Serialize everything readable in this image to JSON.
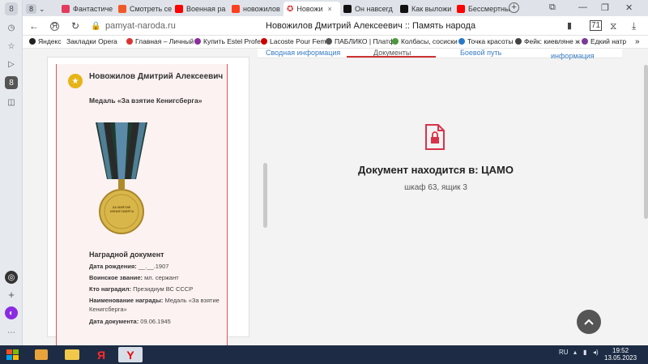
{
  "tabs": [
    {
      "label": "8",
      "icon": "tab-counter-icon"
    },
    {
      "label": "Фантастиче",
      "icon": "m-icon",
      "color": "#e23b5b"
    },
    {
      "label": "Смотреть се",
      "icon": "play-icon",
      "color": "#f05a28"
    },
    {
      "label": "Военная ра",
      "icon": "youtube-icon",
      "color": "#ff0000"
    },
    {
      "label": "новожилов",
      "icon": "yandex-icon",
      "color": "#fc3f1d"
    },
    {
      "label": "Новожи",
      "icon": "star-icon",
      "color": "#d33",
      "active": true
    },
    {
      "label": "Он навсегд",
      "icon": "plus-icon",
      "color": "#111"
    },
    {
      "label": "Как выложи",
      "icon": "plus-icon",
      "color": "#111"
    },
    {
      "label": "Бессмертны",
      "icon": "youtube-icon",
      "color": "#ff0000"
    }
  ],
  "address": {
    "url": "pamyat-naroda.ru",
    "title": "Новожилов Дмитрий Алексеевич :: Память народа"
  },
  "bookmarks": [
    {
      "label": "Яндекс",
      "color": "#222"
    },
    {
      "label": "Закладки Opera",
      "color": "#888"
    },
    {
      "label": "Главная – Личный",
      "color": "#d33"
    },
    {
      "label": "Купить Estel Profe",
      "color": "#8b2d9b"
    },
    {
      "label": "Lacoste Pour Femi",
      "color": "#c00"
    },
    {
      "label": "ПАБЛИКО | Платф",
      "color": "#555"
    },
    {
      "label": "Колбасы, сосиски",
      "color": "#4a9a3a"
    },
    {
      "label": "Точка красоты",
      "color": "#2a78c8"
    },
    {
      "label": "Фейк: киевляне ж",
      "color": "#444"
    },
    {
      "label": "Едкий натр",
      "color": "#7a3a9a"
    }
  ],
  "card": {
    "person": "Новожилов Дмитрий Алексеевич",
    "medal": "Медаль «За взятие Кенигсберга»",
    "medal_text": "ЗА ВЗЯТИЕ КЕНИГСБЕРГА",
    "doc_heading": "Наградной документ",
    "fields": [
      {
        "label": "Дата рождения:",
        "value": "__.__.1907"
      },
      {
        "label": "Воинское звание:",
        "value": "мл. сержант"
      },
      {
        "label": "Кто наградил:",
        "value": "Президиум ВС СССР"
      },
      {
        "label": "Наименование награды:",
        "value": "Медаль «За взятие Кенигсберга»"
      },
      {
        "label": "Дата документа:",
        "value": "09.06.1945"
      }
    ]
  },
  "panel_tabs": [
    "Сводная информация",
    "Документы",
    "Боевой путь",
    "информация"
  ],
  "document": {
    "message": "Документ находится в: ЦАМО",
    "location": "шкаф 63, ящик 3"
  },
  "taskbar": {
    "lang": "RU",
    "time": "19:52",
    "date": "13.05.2023"
  }
}
